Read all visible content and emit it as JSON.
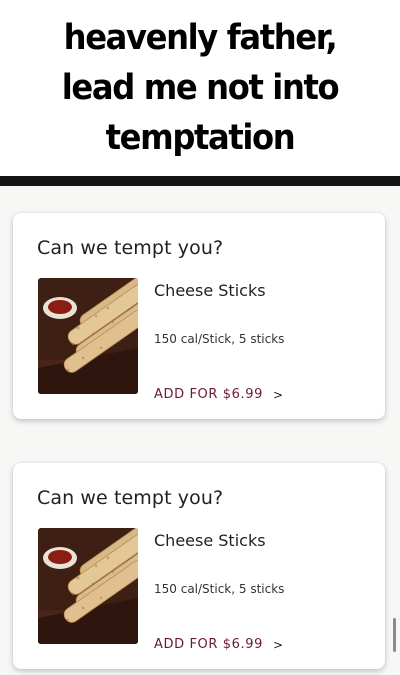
{
  "caption": {
    "text": "heavenly father, lead me not into temptation"
  },
  "cards": [
    {
      "title": "Can we tempt you?",
      "product_name": "Cheese Sticks",
      "calories": "150 cal/Stick, 5 sticks",
      "add_label": "ADD FOR $6.99",
      "chevron": ">",
      "image_icon": "cheese-sticks-photo"
    },
    {
      "title": "Can we tempt you?",
      "product_name": "Cheese Sticks",
      "calories": "150 cal/Stick, 5 sticks",
      "add_label": "ADD FOR $6.99",
      "chevron": ">",
      "image_icon": "cheese-sticks-photo"
    }
  ],
  "colors": {
    "accent": "#6b1a30",
    "divider": "#141414",
    "background": "#f7f7f6"
  }
}
